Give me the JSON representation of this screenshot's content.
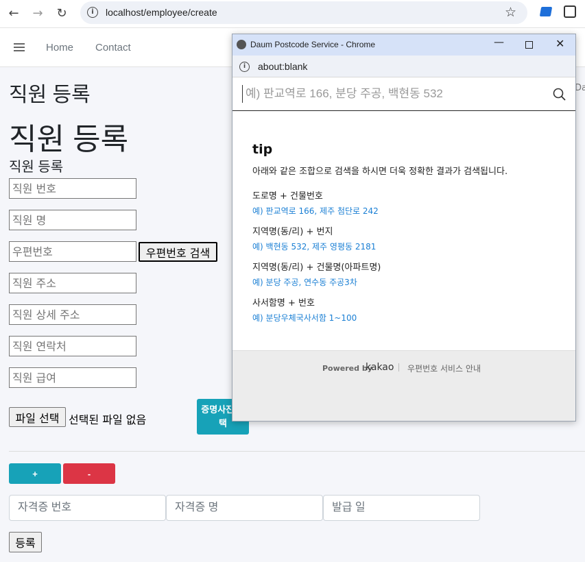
{
  "browser": {
    "url": "localhost/employee/create"
  },
  "navbar": {
    "links": [
      "Home",
      "Contact"
    ]
  },
  "page": {
    "heading_small": "직원 등록",
    "heading_large": "직원 등록",
    "heading_form": "직원 등록",
    "fields": {
      "emp_no": "직원 번호",
      "emp_name": "직원 명",
      "postcode": "우편번호",
      "address": "직원 주소",
      "address_detail": "직원 상세 주소",
      "phone": "직원 연락처",
      "salary": "직원 급여"
    },
    "postcode_button": "우편번호 검색",
    "file_button": "파일 선택",
    "file_status": "선택된 파일 없음",
    "cert_button": "증명사진 선택",
    "add_button": "+",
    "remove_button": "-",
    "cert_fields": {
      "cert_no": "자격증 번호",
      "cert_name": "자격증 명",
      "issue_date": "발급 일"
    },
    "submit_button": "등록",
    "right_edge_text": "Da"
  },
  "popup": {
    "title": "Daum Postcode Service - Chrome",
    "address": "about:blank",
    "search_placeholder": "예) 판교역로 166, 분당 주공, 백현동 532",
    "tip_heading": "tip",
    "tip_desc": "아래와 같은 조합으로 검색을 하시면 더욱 정확한 결과가 검색됩니다.",
    "tips": [
      {
        "label": "도로명 + 건물번호",
        "example": "예) 판교역로 166,  제주 첨단로 242"
      },
      {
        "label": "지역명(동/리) + 번지",
        "example": "예) 백현동 532,  제주 영평동 2181"
      },
      {
        "label": "지역명(동/리) + 건물명(아파트명)",
        "example": "예) 분당 주공,  연수동 주공3차"
      },
      {
        "label": "사서함명 + 번호",
        "example": "예) 분당우체국사서함 1~100"
      }
    ],
    "powered_by": "Powered by",
    "brand": "kakao",
    "service_info": "우편번호 서비스 안내"
  },
  "colors": {
    "accent": "#17a2b8",
    "danger": "#dc3545",
    "link": "#1a7fd4"
  }
}
